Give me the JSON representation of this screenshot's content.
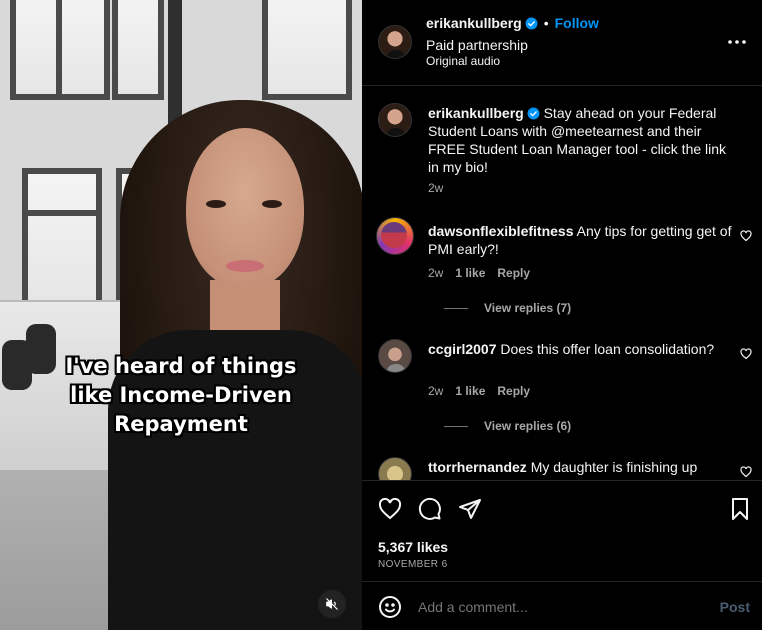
{
  "video": {
    "caption_lines": [
      "I've heard of things",
      "like Income-Driven",
      "Repayment"
    ],
    "mute_icon": "speaker-muted-icon"
  },
  "header": {
    "username": "erikankullberg",
    "follow_label": "Follow",
    "separator": "•",
    "subtitle": "Paid partnership",
    "audio": "Original audio",
    "more_icon": "more-horizontal-icon"
  },
  "caption_post": {
    "username": "erikankullberg",
    "text": "Stay ahead on your Federal Student Loans with @meetearnest and their FREE Student Loan Manager tool - click the link in my bio!",
    "age": "2w"
  },
  "comments": [
    {
      "username": "dawsonflexiblefitness",
      "text": "Any tips for getting get of PMI early?!",
      "age": "2w",
      "likes": "1 like",
      "reply": "Reply",
      "view_replies": "View replies (7)"
    },
    {
      "username": "ccgirl2007",
      "text": "Does this offer loan consolidation?",
      "age": "2w",
      "likes": "1 like",
      "reply": "Reply",
      "view_replies": "View replies (6)"
    },
    {
      "username": "ttorrhernandez",
      "text": "My daughter is finishing up"
    }
  ],
  "actions": {
    "likes": "5,367 likes",
    "date": "NOVEMBER 6"
  },
  "comment_box": {
    "placeholder": "Add a comment...",
    "post_label": "Post"
  },
  "colors": {
    "accent": "#0095f6",
    "background": "#000000",
    "muted_text": "#a8a8a8",
    "divider": "#262626"
  }
}
